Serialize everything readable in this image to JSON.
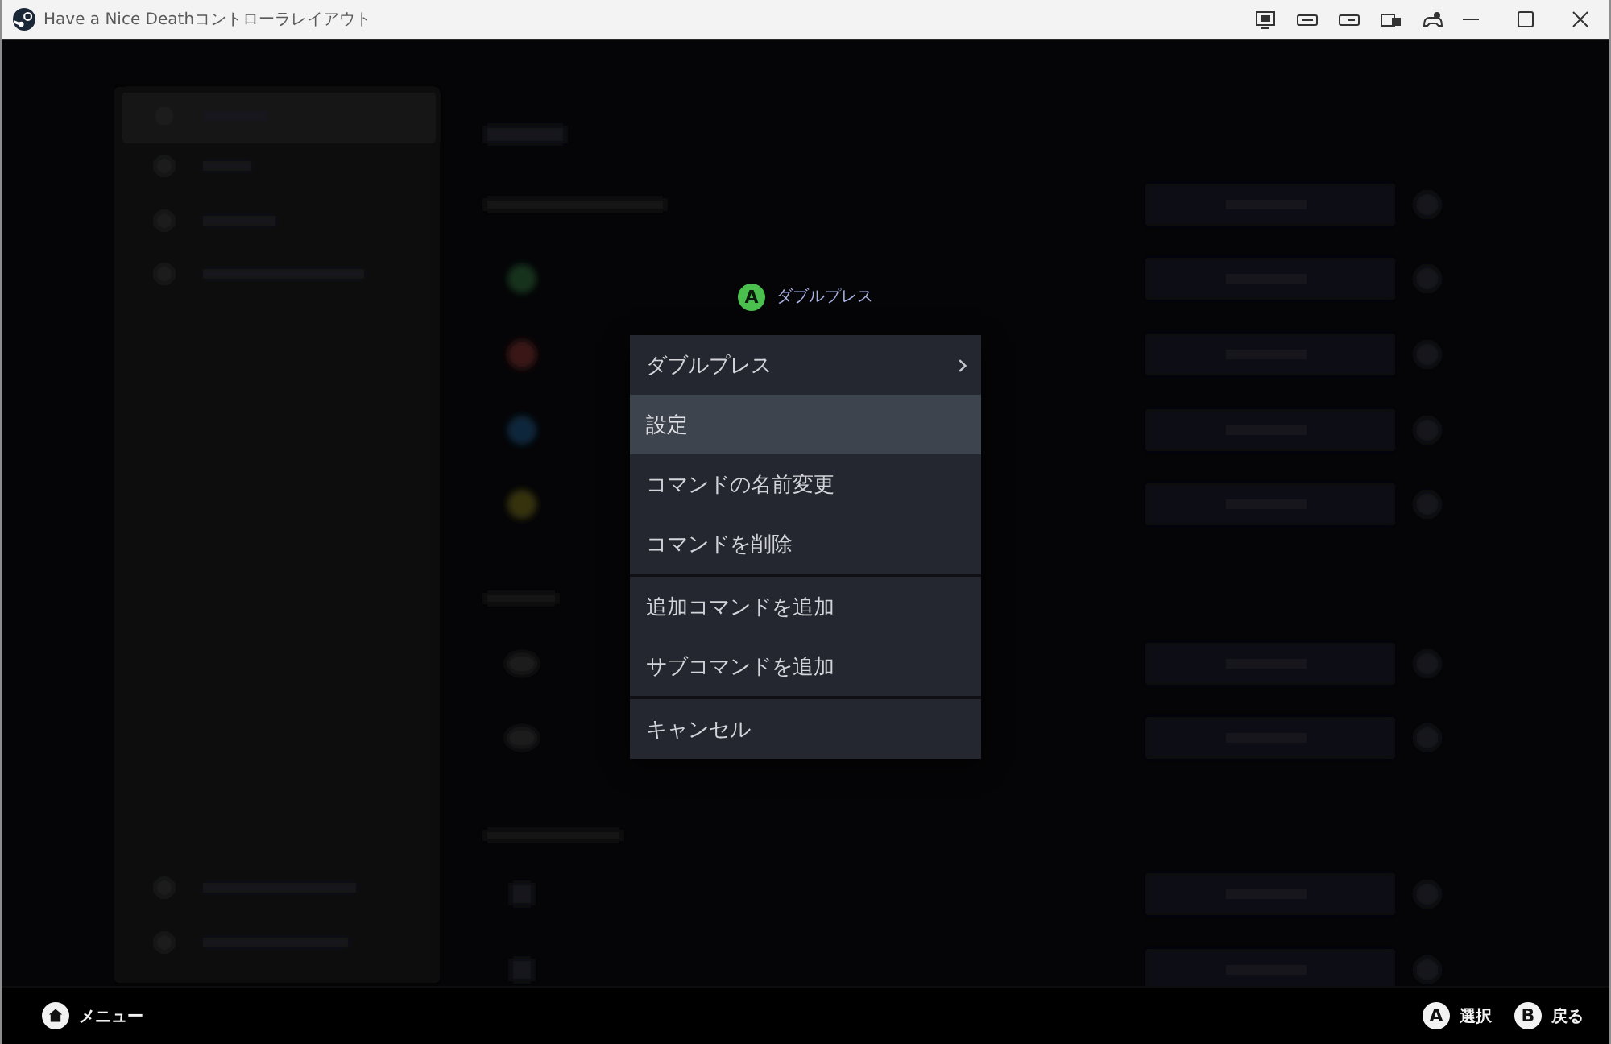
{
  "window": {
    "title": "Have a Nice Deathコントローラレイアウト"
  },
  "prompt": {
    "button": "A",
    "label": "ダブルプレス"
  },
  "menu": {
    "groups": [
      {
        "items": [
          {
            "label": "ダブルプレス",
            "submenu": true,
            "selected": false
          },
          {
            "label": "設定",
            "submenu": false,
            "selected": true
          },
          {
            "label": "コマンドの名前変更",
            "submenu": false,
            "selected": false
          },
          {
            "label": "コマンドを削除",
            "submenu": false,
            "selected": false
          }
        ]
      },
      {
        "items": [
          {
            "label": "追加コマンドを追加",
            "submenu": false,
            "selected": false
          },
          {
            "label": "サブコマンドを追加",
            "submenu": false,
            "selected": false
          }
        ]
      },
      {
        "items": [
          {
            "label": "キャンセル",
            "submenu": false,
            "selected": false
          }
        ]
      }
    ]
  },
  "footer": {
    "left": [
      {
        "kind": "home",
        "label": "メニュー"
      }
    ],
    "right": [
      {
        "kind": "button",
        "button": "A",
        "label": "選択"
      },
      {
        "kind": "button",
        "button": "B",
        "label": "戻る"
      }
    ]
  }
}
